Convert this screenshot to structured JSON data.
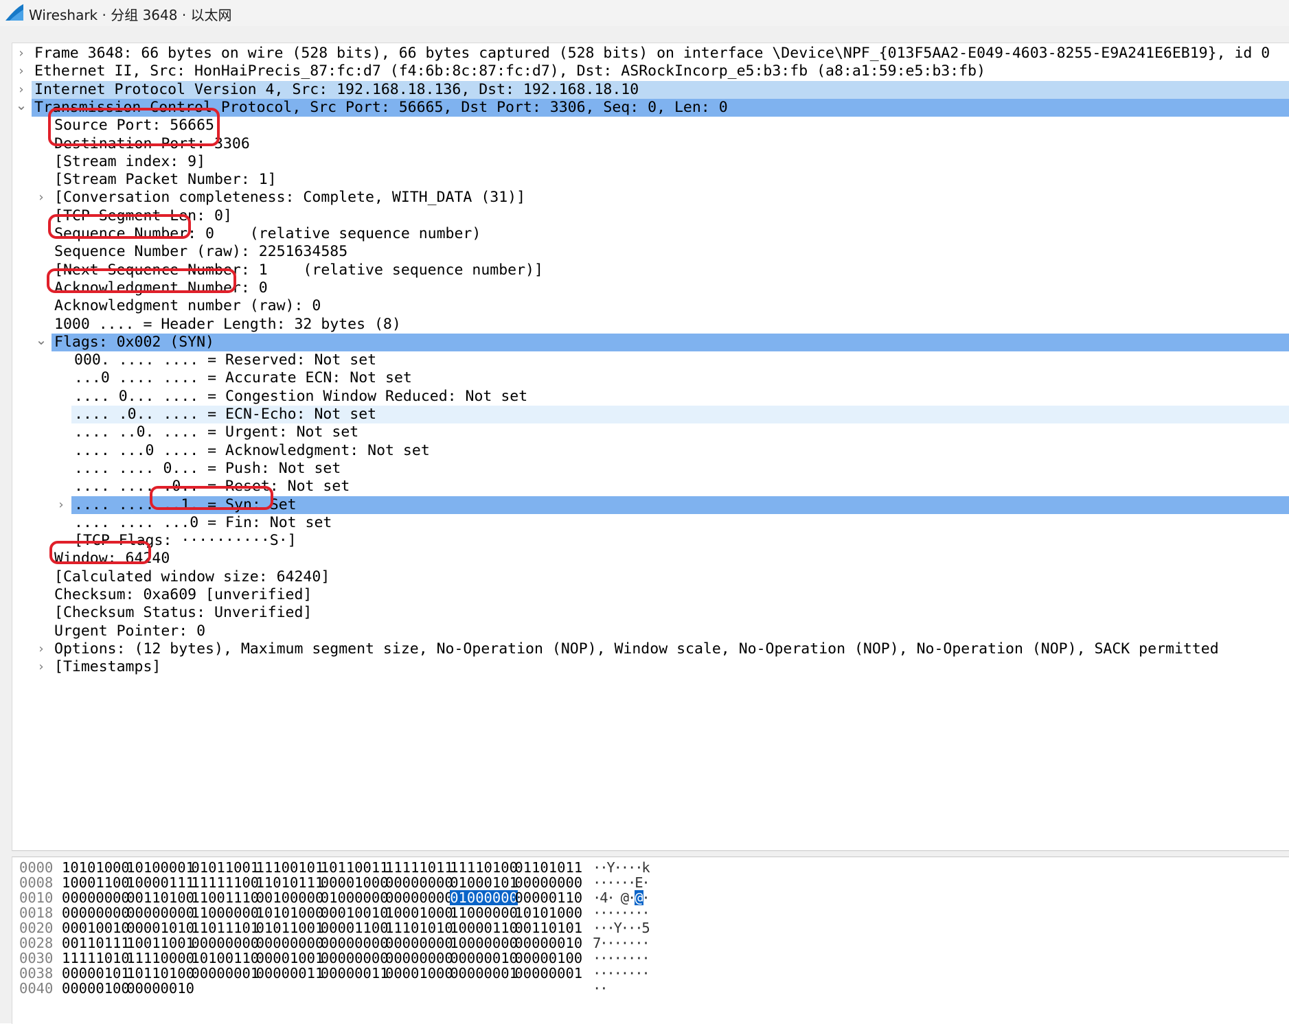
{
  "window": {
    "title": "Wireshark · 分组 3648 · 以太网"
  },
  "colors": {
    "selected_row": "#7fb2ef",
    "light_row": "#bcd9f5",
    "hover_row": "#e4f1fc",
    "annotation_red": "#e0202a",
    "hex_selection": "#0a64c8"
  },
  "tree": [
    {
      "text": "Frame 3648: 66 bytes on wire (528 bits), 66 bytes captured (528 bits) on interface \\Device\\NPF_{013F5AA2-E049-4603-8255-E9A241E6EB19}, id 0",
      "level": 0,
      "arrow": "collapsed",
      "style": "",
      "name": "tree-row-frame"
    },
    {
      "text": "Ethernet II, Src: HonHaiPrecis_87:fc:d7 (f4:6b:8c:87:fc:d7), Dst: ASRockIncorp_e5:b3:fb (a8:a1:59:e5:b3:fb)",
      "level": 0,
      "arrow": "collapsed",
      "style": "",
      "name": "tree-row-ethernet"
    },
    {
      "text": "Internet Protocol Version 4, Src: 192.168.18.136, Dst: 192.168.18.10",
      "level": 0,
      "arrow": "collapsed",
      "style": "light",
      "name": "tree-row-ipv4"
    },
    {
      "text": "Transmission Control Protocol, Src Port: 56665, Dst Port: 3306, Seq: 0, Len: 0",
      "level": 0,
      "arrow": "expanded",
      "style": "selected",
      "name": "tree-row-tcp"
    },
    {
      "text": "Source Port: 56665",
      "level": 1,
      "arrow": "",
      "style": "",
      "name": "tree-row-source-port"
    },
    {
      "text": "Destination Port: 3306",
      "level": 1,
      "arrow": "",
      "style": "",
      "name": "tree-row-destination-port"
    },
    {
      "text": "[Stream index: 9]",
      "level": 1,
      "arrow": "",
      "style": "",
      "name": "tree-row-stream-index"
    },
    {
      "text": "[Stream Packet Number: 1]",
      "level": 1,
      "arrow": "",
      "style": "",
      "name": "tree-row-stream-packet-number"
    },
    {
      "text": "[Conversation completeness: Complete, WITH_DATA (31)]",
      "level": 1,
      "arrow": "collapsed",
      "style": "",
      "name": "tree-row-conversation-completeness"
    },
    {
      "text": "[TCP Segment Len: 0]",
      "level": 1,
      "arrow": "",
      "style": "",
      "name": "tree-row-segment-len"
    },
    {
      "text": "Sequence Number: 0    (relative sequence number)",
      "level": 1,
      "arrow": "",
      "style": "",
      "name": "tree-row-sequence-number"
    },
    {
      "text": "Sequence Number (raw): 2251634585",
      "level": 1,
      "arrow": "",
      "style": "",
      "name": "tree-row-sequence-number-raw"
    },
    {
      "text": "[Next Sequence Number: 1    (relative sequence number)]",
      "level": 1,
      "arrow": "",
      "style": "",
      "name": "tree-row-next-sequence-number"
    },
    {
      "text": "Acknowledgment Number: 0",
      "level": 1,
      "arrow": "",
      "style": "",
      "name": "tree-row-acknowledgment-number"
    },
    {
      "text": "Acknowledgment number (raw): 0",
      "level": 1,
      "arrow": "",
      "style": "",
      "name": "tree-row-acknowledgment-number-raw"
    },
    {
      "text": "1000 .... = Header Length: 32 bytes (8)",
      "level": 1,
      "arrow": "",
      "style": "",
      "name": "tree-row-header-length"
    },
    {
      "text": "Flags: 0x002 (SYN)",
      "level": 1,
      "arrow": "expanded",
      "style": "selected",
      "name": "tree-row-flags"
    },
    {
      "text": "000. .... .... = Reserved: Not set",
      "level": 2,
      "arrow": "",
      "style": "",
      "name": "tree-row-flag-reserved"
    },
    {
      "text": "...0 .... .... = Accurate ECN: Not set",
      "level": 2,
      "arrow": "",
      "style": "",
      "name": "tree-row-flag-accurate-ecn"
    },
    {
      "text": ".... 0... .... = Congestion Window Reduced: Not set",
      "level": 2,
      "arrow": "",
      "style": "",
      "name": "tree-row-flag-cwr"
    },
    {
      "text": ".... .0.. .... = ECN-Echo: Not set",
      "level": 2,
      "arrow": "",
      "style": "hover",
      "name": "tree-row-flag-ecn-echo"
    },
    {
      "text": ".... ..0. .... = Urgent: Not set",
      "level": 2,
      "arrow": "",
      "style": "",
      "name": "tree-row-flag-urgent"
    },
    {
      "text": ".... ...0 .... = Acknowledgment: Not set",
      "level": 2,
      "arrow": "",
      "style": "",
      "name": "tree-row-flag-acknowledgment"
    },
    {
      "text": ".... .... 0... = Push: Not set",
      "level": 2,
      "arrow": "",
      "style": "",
      "name": "tree-row-flag-push"
    },
    {
      "text": ".... .... .0.. = Reset: Not set",
      "level": 2,
      "arrow": "",
      "style": "",
      "name": "tree-row-flag-reset"
    },
    {
      "text": ".... .... ..1. = Syn: Set",
      "level": 2,
      "arrow": "collapsed",
      "style": "selected",
      "name": "tree-row-flag-syn"
    },
    {
      "text": ".... .... ...0 = Fin: Not set",
      "level": 2,
      "arrow": "",
      "style": "",
      "name": "tree-row-flag-fin"
    },
    {
      "text": "[TCP Flags: ··········S·]",
      "level": 2,
      "arrow": "",
      "style": "",
      "name": "tree-row-tcp-flags-summary"
    },
    {
      "text": "Window: 64240",
      "level": 1,
      "arrow": "",
      "style": "",
      "name": "tree-row-window"
    },
    {
      "text": "[Calculated window size: 64240]",
      "level": 1,
      "arrow": "",
      "style": "",
      "name": "tree-row-calculated-window"
    },
    {
      "text": "Checksum: 0xa609 [unverified]",
      "level": 1,
      "arrow": "",
      "style": "",
      "name": "tree-row-checksum"
    },
    {
      "text": "[Checksum Status: Unverified]",
      "level": 1,
      "arrow": "",
      "style": "",
      "name": "tree-row-checksum-status"
    },
    {
      "text": "Urgent Pointer: 0",
      "level": 1,
      "arrow": "",
      "style": "",
      "name": "tree-row-urgent-pointer"
    },
    {
      "text": "Options: (12 bytes), Maximum segment size, No-Operation (NOP), Window scale, No-Operation (NOP), No-Operation (NOP), SACK permitted",
      "level": 1,
      "arrow": "collapsed",
      "style": "",
      "name": "tree-row-options"
    },
    {
      "text": "[Timestamps]",
      "level": 1,
      "arrow": "collapsed",
      "style": "",
      "name": "tree-row-timestamps"
    }
  ],
  "hex": [
    {
      "offset": "0000",
      "bytes": [
        "10101000",
        "10100001",
        "01011001",
        "11100101",
        "10110011",
        "11111011",
        "11110100",
        "01101011"
      ],
      "ascii": [
        "·",
        "·",
        "Y",
        "·",
        "·",
        "·",
        "·",
        "k"
      ]
    },
    {
      "offset": "0008",
      "bytes": [
        "10001100",
        "10000111",
        "11111100",
        "11010111",
        "00001000",
        "00000000",
        "01000101",
        "00000000"
      ],
      "ascii": [
        "·",
        "·",
        "·",
        "·",
        "·",
        "·",
        "E",
        "·"
      ]
    },
    {
      "offset": "0010",
      "bytes": [
        "00000000",
        "00110100",
        "11001110",
        "00100000",
        "01000000",
        "00000000",
        "01000000",
        "00000110"
      ],
      "ascii": [
        "·",
        "4",
        "·",
        " ",
        "@",
        "·",
        "@",
        "·"
      ],
      "selected_index": 6
    },
    {
      "offset": "0018",
      "bytes": [
        "00000000",
        "00000000",
        "11000000",
        "10101000",
        "00010010",
        "10001000",
        "11000000",
        "10101000"
      ],
      "ascii": [
        "·",
        "·",
        "·",
        "·",
        "·",
        "·",
        "·",
        "·"
      ]
    },
    {
      "offset": "0020",
      "bytes": [
        "00010010",
        "00001010",
        "11011101",
        "01011001",
        "00001100",
        "11101010",
        "10000110",
        "00110101"
      ],
      "ascii": [
        "·",
        "·",
        "·",
        "Y",
        "·",
        "·",
        "·",
        "5"
      ]
    },
    {
      "offset": "0028",
      "bytes": [
        "00110111",
        "10011001",
        "00000000",
        "00000000",
        "00000000",
        "00000000",
        "10000000",
        "00000010"
      ],
      "ascii": [
        "7",
        "·",
        "·",
        "·",
        "·",
        "·",
        "·",
        "·"
      ]
    },
    {
      "offset": "0030",
      "bytes": [
        "11111010",
        "11110000",
        "10100110",
        "00001001",
        "00000000",
        "00000000",
        "00000010",
        "00000100"
      ],
      "ascii": [
        "·",
        "·",
        "·",
        "·",
        "·",
        "·",
        "·",
        "·"
      ]
    },
    {
      "offset": "0038",
      "bytes": [
        "00000101",
        "10110100",
        "00000001",
        "00000011",
        "00000011",
        "00001000",
        "00000001",
        "00000001"
      ],
      "ascii": [
        "·",
        "·",
        "·",
        "·",
        "·",
        "·",
        "·",
        "·"
      ]
    },
    {
      "offset": "0040",
      "bytes": [
        "00000100",
        "00000010"
      ],
      "ascii": [
        "·",
        "·"
      ]
    }
  ]
}
